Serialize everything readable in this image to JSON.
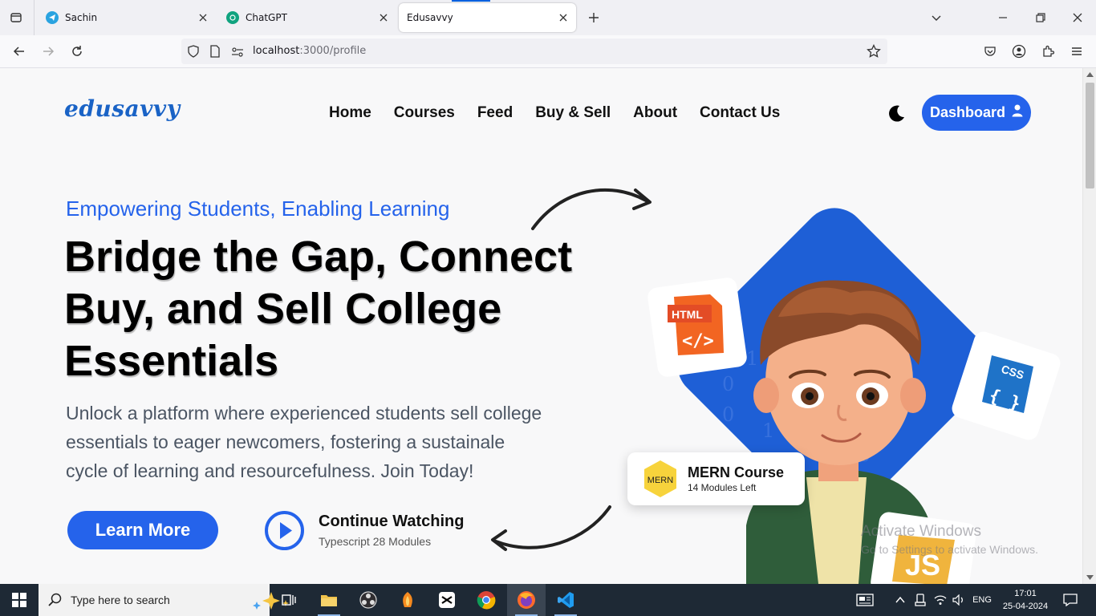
{
  "browser": {
    "tabs": [
      {
        "title": "Sachin",
        "active": false
      },
      {
        "title": "ChatGPT",
        "active": false
      },
      {
        "title": "Edusavvy",
        "active": true
      }
    ],
    "url": {
      "host": "localhost",
      "path": ":3000/profile"
    }
  },
  "site": {
    "logo": "edusavvy",
    "nav": [
      "Home",
      "Courses",
      "Feed",
      "Buy & Sell",
      "About",
      "Contact Us"
    ],
    "dashboard_label": "Dashboard"
  },
  "hero": {
    "eyebrow": "Empowering Students, Enabling Learning",
    "headline_lines": [
      "Bridge the Gap, Connect",
      "Buy, and Sell College",
      "Essentials"
    ],
    "subtext_lines": [
      "Unlock a platform where experienced students sell college",
      "essentials to eager newcomers, fostering a sustainale",
      "cycle of learning and resourcefulness. Join Today!"
    ],
    "learn_more": "Learn More",
    "continue_title": "Continue Watching",
    "continue_sub": "Typescript 28 Modules",
    "html_badge": "HTML",
    "css_badge": "CSS",
    "js_badge": "JS",
    "mern_badge": "MERN",
    "mern_title": "MERN Course",
    "mern_sub": "14 Modules Left"
  },
  "watermark": {
    "line1": "Activate Windows",
    "line2": "Go to Settings to activate Windows."
  },
  "taskbar": {
    "search_placeholder": "Type here to search",
    "lang": "ENG",
    "time": "17:01",
    "date": "25-04-2024"
  }
}
